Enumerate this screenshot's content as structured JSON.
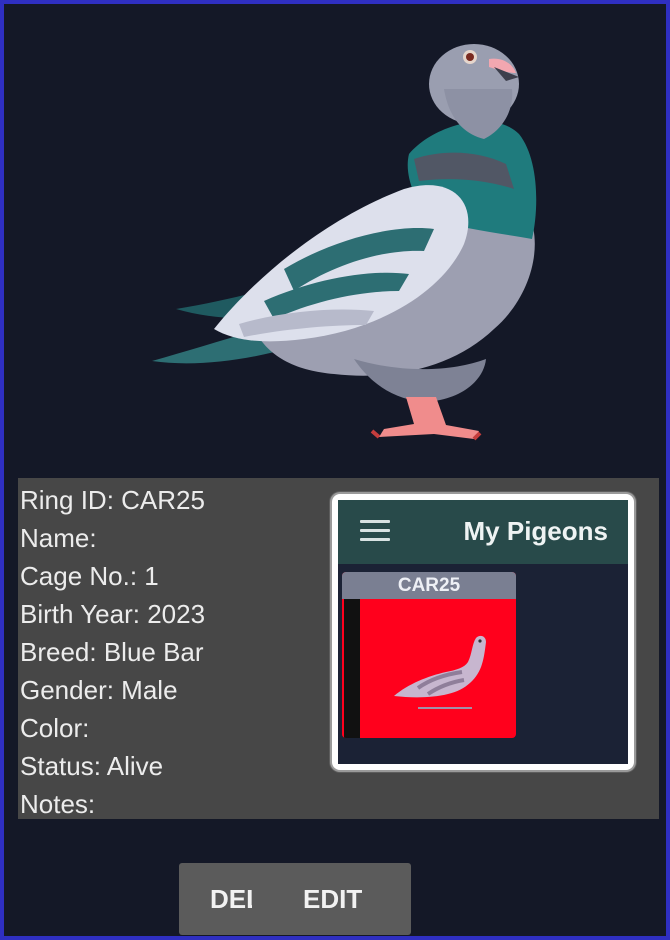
{
  "details": {
    "ring_id": "Ring ID: CAR25",
    "name": "Name:",
    "cage_no": "Cage No.: 1",
    "birth_year": "Birth Year: 2023",
    "breed": "Breed: Blue Bar",
    "gender": "Gender: Male",
    "color": "Color:",
    "status": "Status: Alive",
    "notes": "Notes:"
  },
  "preview": {
    "app_title": "My Pigeons",
    "card_label": "CAR25",
    "menu_icon": "hamburger-menu-icon"
  },
  "actions": {
    "delete_label": "DELETE",
    "edit_label": "EDIT"
  },
  "colors": {
    "background": "#141827",
    "border": "#2f2fc2",
    "panel": "#474747",
    "appbar": "#284a4a",
    "card": "#ff001c"
  }
}
